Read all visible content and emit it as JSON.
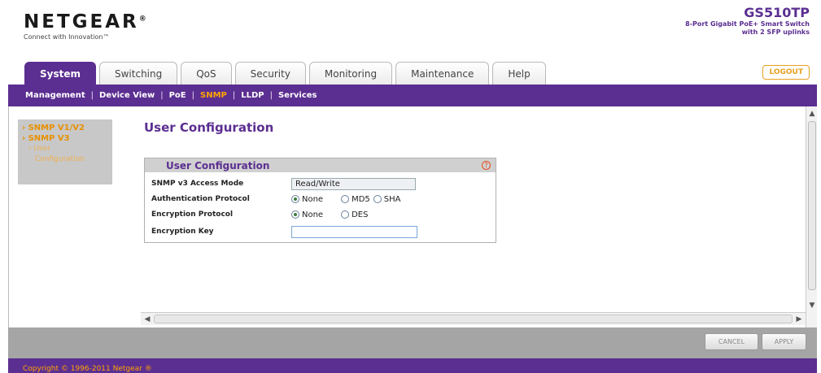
{
  "header": {
    "brand": "NETGEAR",
    "brand_mark": "®",
    "tagline": "Connect with Innovation™",
    "model": "GS510TP",
    "model_desc_line1": "8-Port Gigabit PoE+ Smart Switch",
    "model_desc_line2": "with 2 SFP uplinks",
    "logout_label": "LOGOUT"
  },
  "tabs": [
    {
      "label": "System",
      "active": true
    },
    {
      "label": "Switching",
      "active": false
    },
    {
      "label": "QoS",
      "active": false
    },
    {
      "label": "Security",
      "active": false
    },
    {
      "label": "Monitoring",
      "active": false
    },
    {
      "label": "Maintenance",
      "active": false
    },
    {
      "label": "Help",
      "active": false
    }
  ],
  "subnav": [
    {
      "label": "Management",
      "active": false
    },
    {
      "label": "Device View",
      "active": false
    },
    {
      "label": "PoE",
      "active": false
    },
    {
      "label": "SNMP",
      "active": true
    },
    {
      "label": "LLDP",
      "active": false
    },
    {
      "label": "Services",
      "active": false
    }
  ],
  "subnav_separator": "|",
  "sidebar": {
    "items": [
      {
        "label": "› SNMP V1/V2"
      },
      {
        "label": "› SNMP V3"
      },
      {
        "label": "› User"
      },
      {
        "label": "Configuration"
      }
    ]
  },
  "page_title": "User Configuration",
  "panel": {
    "title": "User Configuration",
    "help_icon": "?",
    "fields": {
      "access_mode_label": "SNMP v3 Access Mode",
      "access_mode_value": "Read/Write",
      "auth_label": "Authentication Protocol",
      "auth_options": [
        "None",
        "MD5",
        "SHA"
      ],
      "auth_selected": "None",
      "enc_label": "Encryption Protocol",
      "enc_options": [
        "None",
        "DES"
      ],
      "enc_selected": "None",
      "key_label": "Encryption Key",
      "key_value": ""
    }
  },
  "buttons": {
    "cancel": "CANCEL",
    "apply": "APPLY"
  },
  "footer": {
    "copyright": "Copyright © 1996-2011 Netgear ®"
  },
  "colors": {
    "accent": "#5b2e91",
    "highlight": "#ffa500"
  }
}
